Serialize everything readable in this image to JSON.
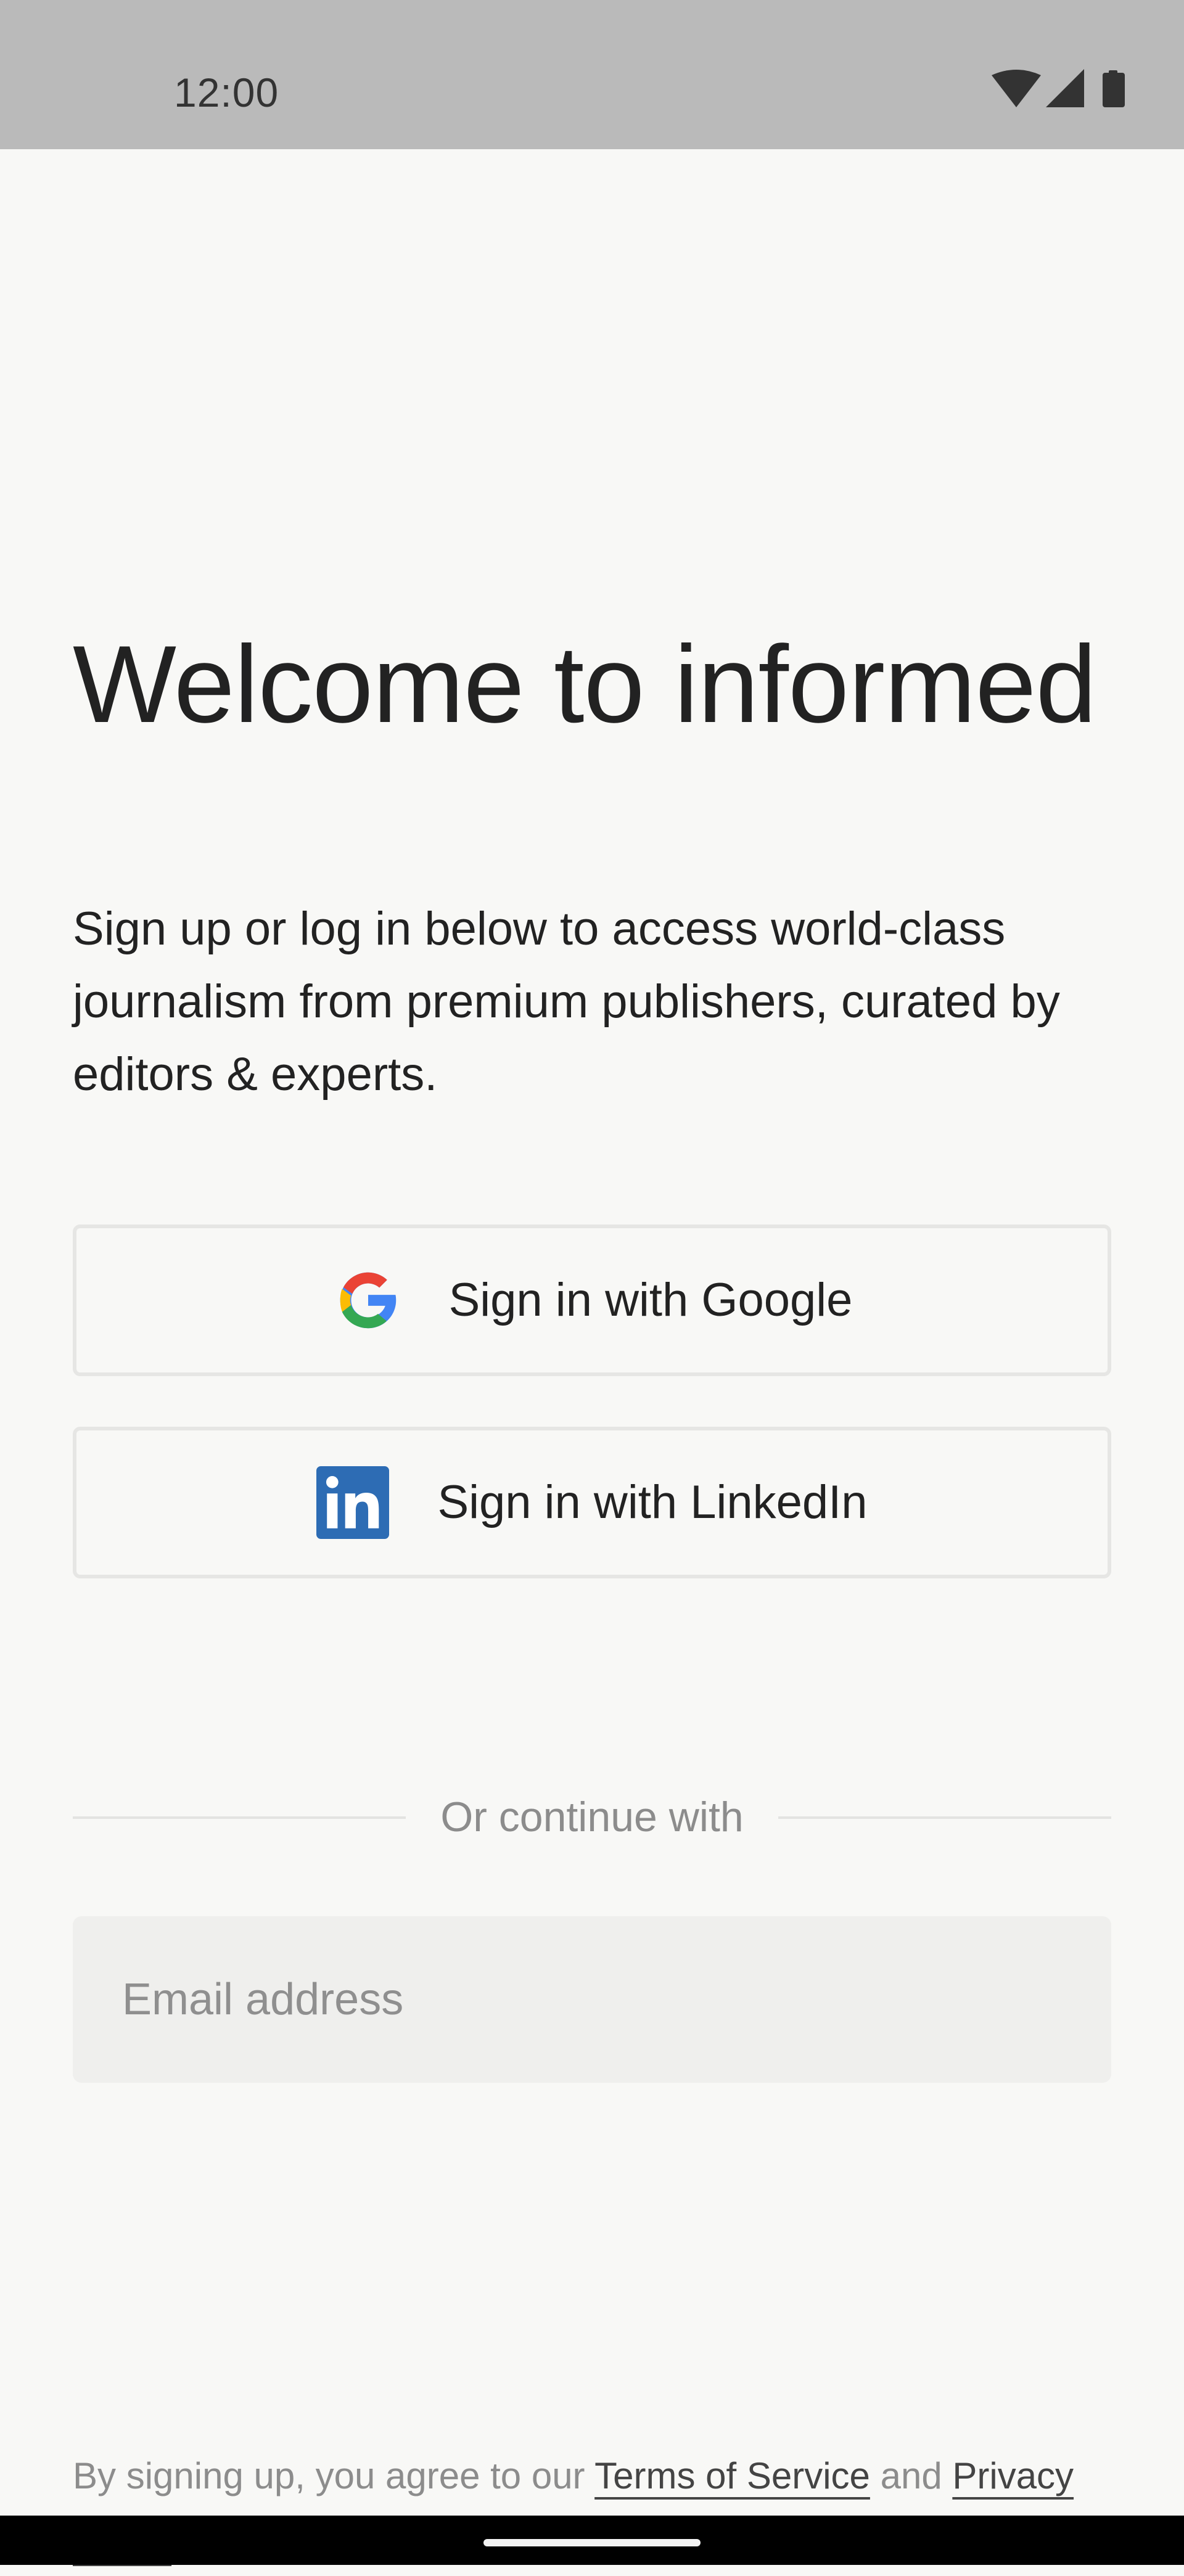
{
  "status_bar": {
    "time": "12:00",
    "icons": [
      "wifi-icon",
      "cellular-signal-icon",
      "battery-icon"
    ]
  },
  "welcome": {
    "title": "Welcome to informed",
    "subtitle": "Sign up or log in below to access world-class journalism from premium publishers, curated by editors & experts."
  },
  "auth": {
    "google_label": "Sign in with Google",
    "linkedin_label": "Sign in with LinkedIn",
    "divider_text": "Or continue with",
    "email_placeholder": "Email address",
    "email_value": ""
  },
  "legal": {
    "prefix": "By signing up, you agree to our ",
    "terms_link": "Terms of Service",
    "conjunction": " and ",
    "privacy_link": "Privacy Policy"
  },
  "colors": {
    "background": "#f8f8f6",
    "status_bar": "#bababa",
    "linkedin_blue": "#2d6cb4",
    "google_red": "#ea4335",
    "google_yellow": "#fbbc05",
    "google_green": "#34a853",
    "google_blue": "#4285f4"
  }
}
